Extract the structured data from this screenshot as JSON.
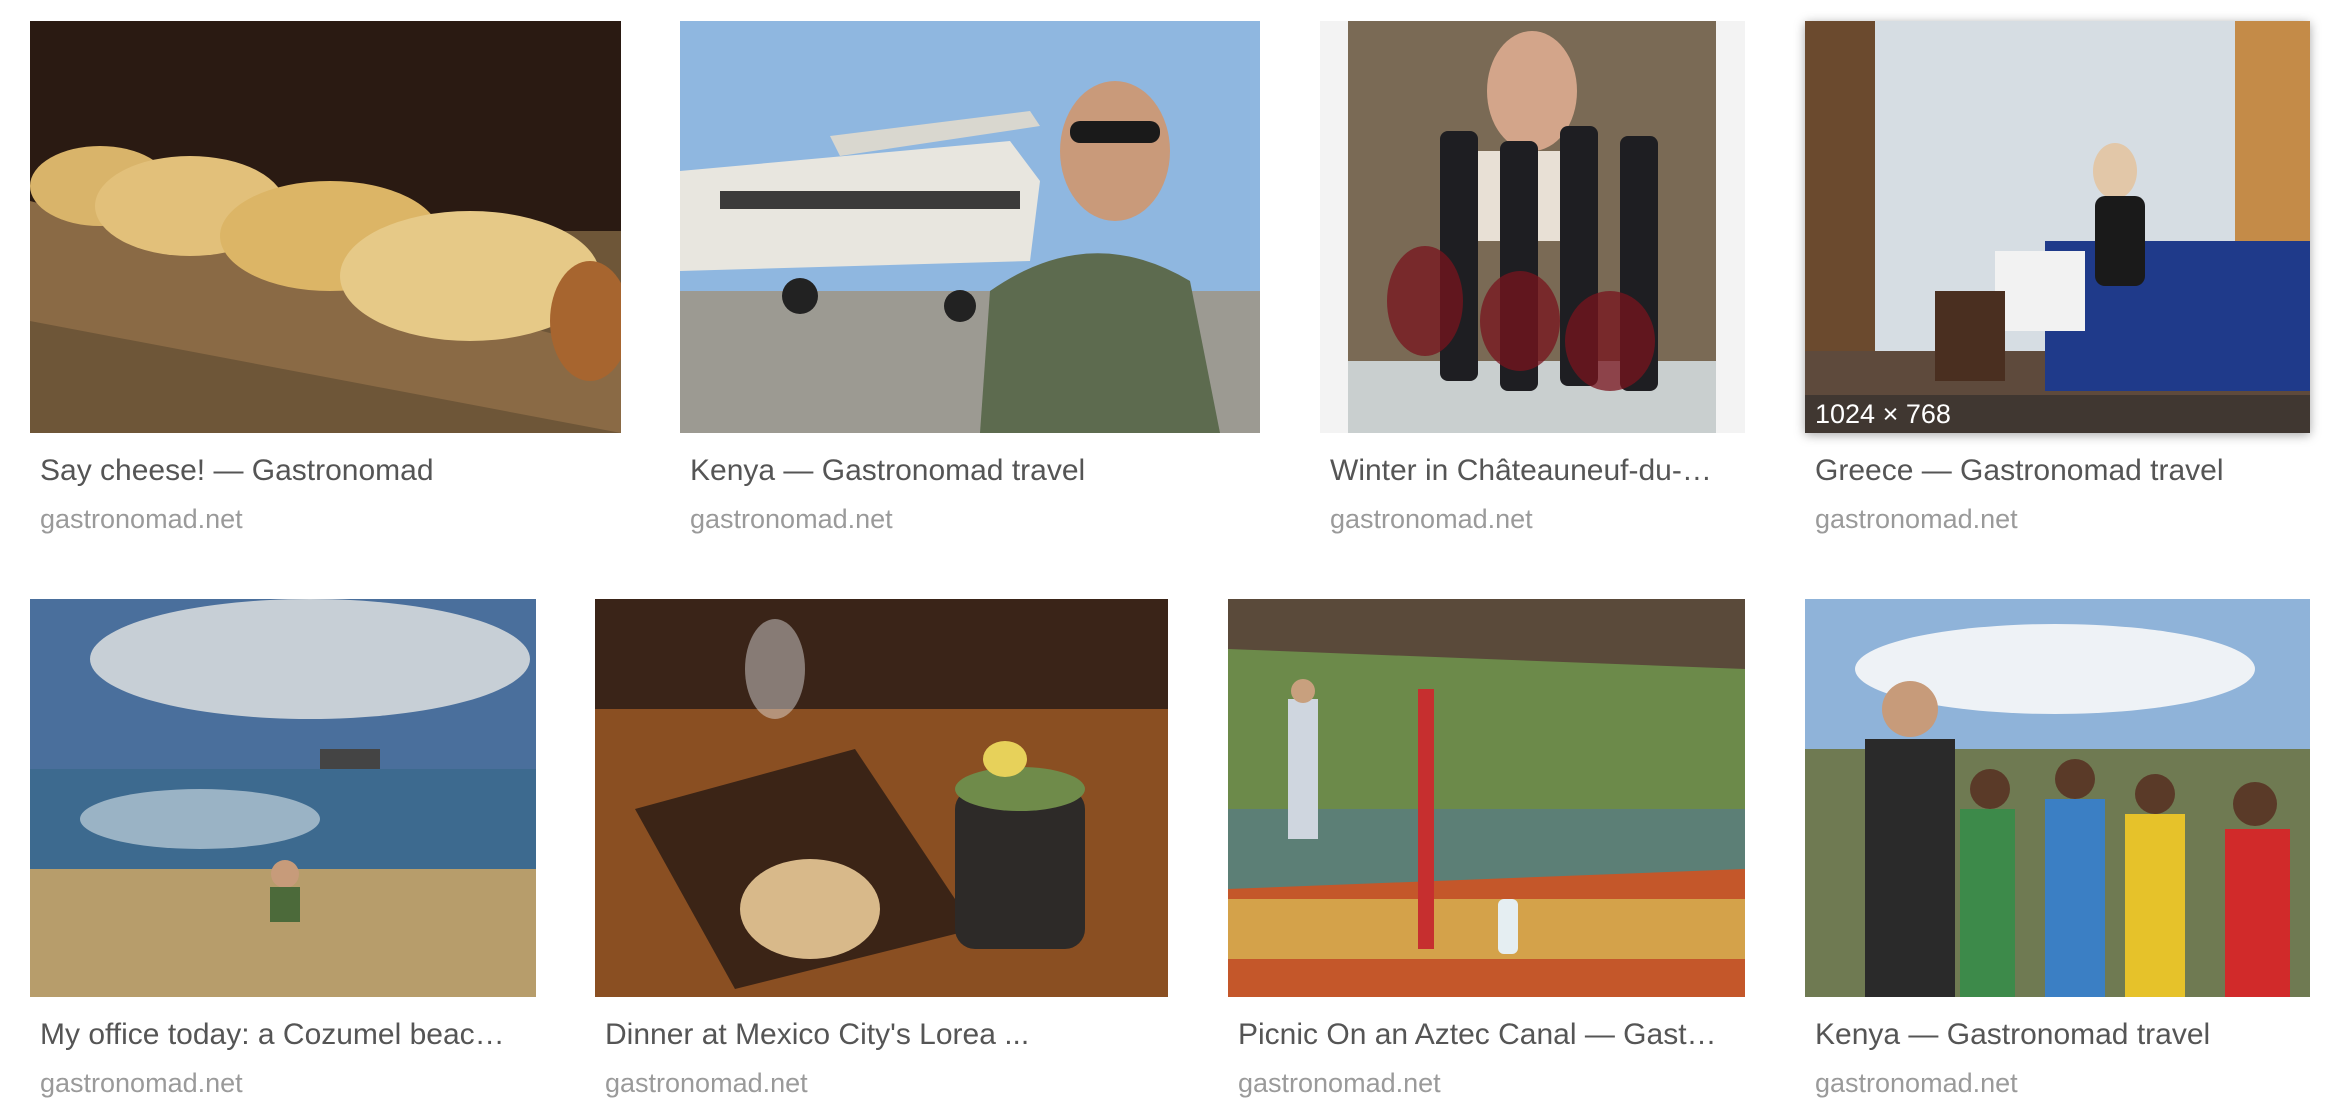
{
  "results": [
    {
      "title": "Say cheese! — Gastronomad",
      "source": "gastronomad.net",
      "image": "cheese-wheels-on-shelf"
    },
    {
      "title": "Kenya — Gastronomad travel",
      "source": "gastronomad.net",
      "image": "man-in-sunglasses-by-airplane"
    },
    {
      "title": "Winter in Châteauneuf-du-…",
      "source": "gastronomad.net",
      "image": "wine-bottles-and-glasses"
    },
    {
      "title": "Greece — Gastronomad travel",
      "source": "gastronomad.net",
      "image": "woman-in-hotel-room",
      "dimensions": "1024 × 768"
    },
    {
      "title": "My office today: a Cozumel beac…",
      "source": "gastronomad.net",
      "image": "man-on-beach"
    },
    {
      "title": "Dinner at Mexico City's Lorea ...",
      "source": "gastronomad.net",
      "image": "bread-and-drink-on-table"
    },
    {
      "title": "Picnic On an Aztec Canal — Gast…",
      "source": "gastronomad.net",
      "image": "boat-on-canal"
    },
    {
      "title": "Kenya — Gastronomad travel",
      "source": "gastronomad.net",
      "image": "man-with-children-group"
    }
  ]
}
